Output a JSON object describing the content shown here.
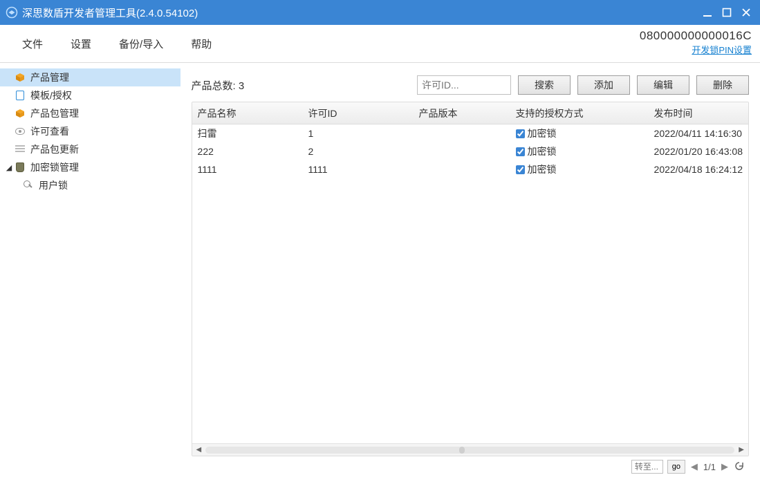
{
  "window": {
    "title": "深思数盾开发者管理工具(2.4.0.54102)"
  },
  "menu": {
    "file": "文件",
    "settings": "设置",
    "backup": "备份/导入",
    "help": "帮助"
  },
  "header_right": {
    "serial": "080000000000016C",
    "pin_link": "开发锁PIN设置"
  },
  "sidebar": {
    "items": [
      {
        "label": "产品管理"
      },
      {
        "label": "模板/授权"
      },
      {
        "label": "产品包管理"
      },
      {
        "label": "许可查看"
      },
      {
        "label": "产品包更新"
      }
    ],
    "lock_group": {
      "label": "加密锁管理"
    },
    "lock_children": [
      {
        "label": "用户锁"
      }
    ]
  },
  "content": {
    "total_label": "产品总数: 3",
    "search_placeholder": "许可ID...",
    "btn_search": "搜索",
    "btn_add": "添加",
    "btn_edit": "编辑",
    "btn_delete": "删除"
  },
  "table": {
    "headers": {
      "name": "产品名称",
      "license": "许可ID",
      "version": "产品版本",
      "auth": "支持的授权方式",
      "time": "发布时间"
    },
    "auth_option": "加密锁",
    "rows": [
      {
        "name": "扫雷",
        "license": "1",
        "version": "",
        "time": "2022/04/11 14:16:30"
      },
      {
        "name": "222",
        "license": "2",
        "version": "",
        "time": "2022/01/20 16:43:08"
      },
      {
        "name": "1111",
        "license": "1111",
        "version": "",
        "time": "2022/04/18 16:24:12"
      }
    ]
  },
  "pager": {
    "goto_placeholder": "转至...",
    "go": "go",
    "page_info": "1/1"
  }
}
